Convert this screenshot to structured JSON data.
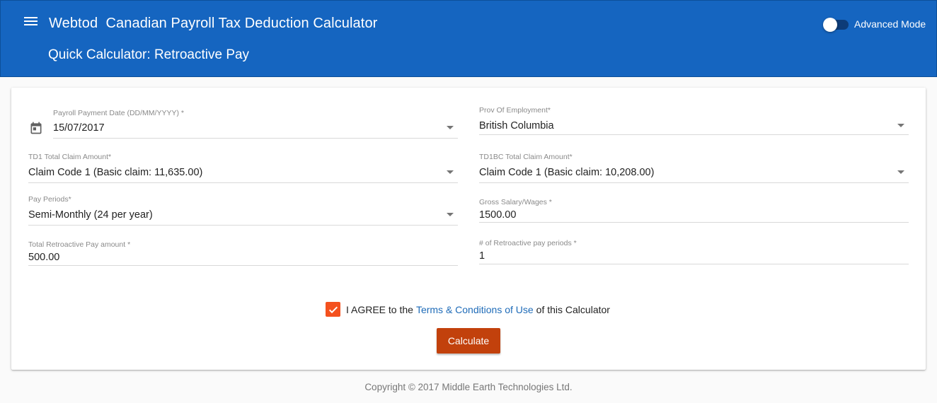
{
  "app": {
    "title": "Webtod  Canadian Payroll Tax Deduction Calculator",
    "subtitle": "Quick Calculator: Retroactive Pay",
    "advanced_mode_label": "Advanced Mode",
    "advanced_mode_on": false
  },
  "form": {
    "payment_date": {
      "label": "Payroll Payment Date (DD/MM/YYYY) *",
      "value": "15/07/2017"
    },
    "province": {
      "label": "Prov Of Employment*",
      "value": "British Columbia"
    },
    "td1_claim": {
      "label": "TD1 Total Claim Amount*",
      "value": "Claim Code 1 (Basic claim: 11,635.00)"
    },
    "td1bc_claim": {
      "label": "TD1BC Total Claim Amount*",
      "value": "Claim Code 1 (Basic claim: 10,208.00)"
    },
    "pay_periods": {
      "label": "Pay Periods*",
      "value": "Semi-Monthly (24 per year)"
    },
    "gross_salary": {
      "label": "Gross Salary/Wages *",
      "value": "1500.00"
    },
    "retro_amount": {
      "label": "Total Retroactive Pay amount *",
      "value": "500.00"
    },
    "retro_periods": {
      "label": "# of Retroactive pay periods *",
      "value": "1"
    }
  },
  "agreement": {
    "checked": true,
    "prefix": "I AGREE to the",
    "link": "Terms & Conditions of Use",
    "suffix": "of this Calculator"
  },
  "actions": {
    "calculate_label": "Calculate"
  },
  "footer": {
    "copyright": "Copyright © 2017 Middle Earth Technologies Ltd."
  },
  "colors": {
    "appbar": "#1565c0",
    "checkbox": "#f4511e",
    "button": "#c2410c",
    "link": "#1e6bb8"
  }
}
